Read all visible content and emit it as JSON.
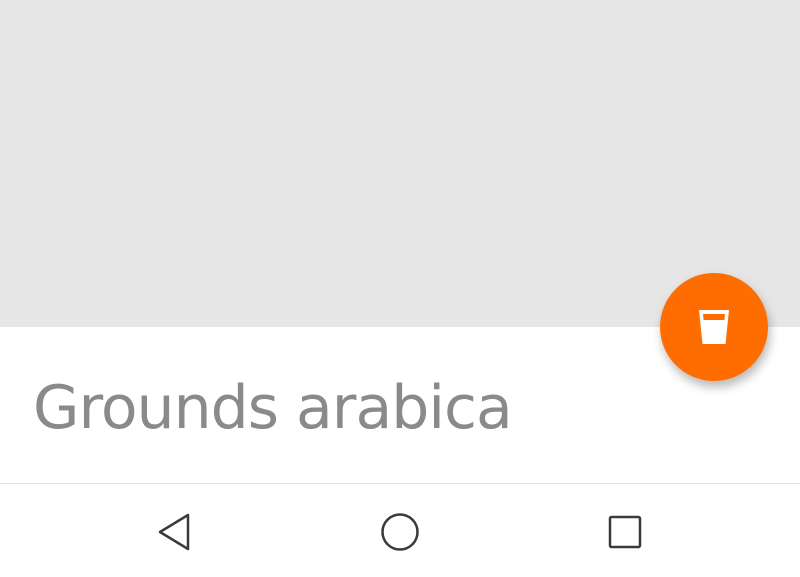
{
  "detail": {
    "title": "Grounds arabica",
    "header_image_color": "#e6e6e6"
  },
  "fab": {
    "icon": "cup-icon",
    "color": "#ff6d00"
  },
  "navigation_bar": {
    "back_icon": "back-triangle-icon",
    "home_icon": "home-circle-icon",
    "recents_icon": "recents-square-icon"
  }
}
